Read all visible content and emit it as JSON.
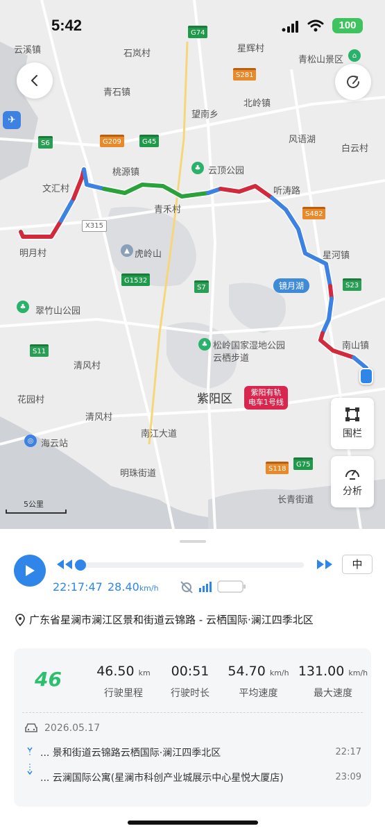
{
  "status_bar": {
    "time": "5:42",
    "battery": "100"
  },
  "map": {
    "places": [
      {
        "id": "yunxi",
        "text": "云溪镇"
      },
      {
        "id": "shilan",
        "text": "石岚村"
      },
      {
        "id": "xinghui",
        "text": "星辉村"
      },
      {
        "id": "qingsong",
        "text": "青松山景区"
      },
      {
        "id": "qingshi",
        "text": "青石镇"
      },
      {
        "id": "wangnan",
        "text": "望南乡"
      },
      {
        "id": "beiling",
        "text": "北岭镇"
      },
      {
        "id": "fengyu",
        "text": "风语湖"
      },
      {
        "id": "baiyun",
        "text": "白云村"
      },
      {
        "id": "taoyuan",
        "text": "桃源镇"
      },
      {
        "id": "yunding",
        "text": "云顶公园"
      },
      {
        "id": "wenhui",
        "text": "文汇村"
      },
      {
        "id": "tingtao",
        "text": "听涛路"
      },
      {
        "id": "qinghe",
        "text": "青禾村"
      },
      {
        "id": "mingyue",
        "text": "明月村"
      },
      {
        "id": "huling",
        "text": "虎岭山"
      },
      {
        "id": "xinghe",
        "text": "星河镇"
      },
      {
        "id": "cuizhu",
        "text": "翠竹山公园"
      },
      {
        "id": "nanshan",
        "text": "南山镇"
      },
      {
        "id": "songling",
        "text": "松岭国家湿地公园"
      },
      {
        "id": "yunqi",
        "text": "云栖步道"
      },
      {
        "id": "qingfeng",
        "text": "清风村"
      },
      {
        "id": "ziyang",
        "text": "紫阳区"
      },
      {
        "id": "huayuan",
        "text": "花园村"
      },
      {
        "id": "qingfeng2",
        "text": "清风村"
      },
      {
        "id": "nanjiang",
        "text": "南江大道"
      },
      {
        "id": "haiyun",
        "text": "海云站"
      },
      {
        "id": "mingzhu",
        "text": "明珠街道"
      },
      {
        "id": "changqing",
        "text": "长青街道"
      }
    ],
    "shields": [
      {
        "id": "g74",
        "text": "G74"
      },
      {
        "id": "s281",
        "text": "S281"
      },
      {
        "id": "s6",
        "text": "S6"
      },
      {
        "id": "g209",
        "text": "G209"
      },
      {
        "id": "g45",
        "text": "G45"
      },
      {
        "id": "s482",
        "text": "S482"
      },
      {
        "id": "x315",
        "text": "X315"
      },
      {
        "id": "g1532",
        "text": "G1532"
      },
      {
        "id": "s7",
        "text": "S7"
      },
      {
        "id": "s23",
        "text": "S23"
      },
      {
        "id": "s11",
        "text": "S11"
      },
      {
        "id": "s118",
        "text": "S118"
      },
      {
        "id": "g75",
        "text": "G75"
      }
    ],
    "lake_tag": "镜月湖",
    "metro_tag_line1": "紫阳有轨",
    "metro_tag_line2": "电车1号线",
    "scale_label": "5公里",
    "fence_label": "围栏",
    "analysis_label": "分析",
    "route_colors": {
      "fast": "#3d82e3",
      "slow": "#d12a3c",
      "smooth": "#2aa13a"
    }
  },
  "playback": {
    "speed_label": "中",
    "time": "22:17:47",
    "speed_value": "28.40",
    "speed_unit": "km/h",
    "progress": 0.0
  },
  "address": "广东省星澜市澜江区景和街道云锦路 - 云栖国际·澜江四季北区",
  "trip": {
    "score": "46",
    "stats": [
      {
        "value": "46.50",
        "unit": "km",
        "label": "行驶里程"
      },
      {
        "value": "00:51",
        "unit": "",
        "label": "行驶时长"
      },
      {
        "value": "54.70",
        "unit": "km/h",
        "label": "平均速度"
      },
      {
        "value": "131.00",
        "unit": "km/h",
        "label": "最大速度"
      }
    ],
    "date": "2026.05.17",
    "start": {
      "text": "... 景和街道云锦路云栖国际·澜江四季北区",
      "time": "22:17"
    },
    "end": {
      "text": "... 云澜国际公寓(星澜市科创产业城展示中心星悦大厦店)",
      "time": "23:09"
    }
  }
}
